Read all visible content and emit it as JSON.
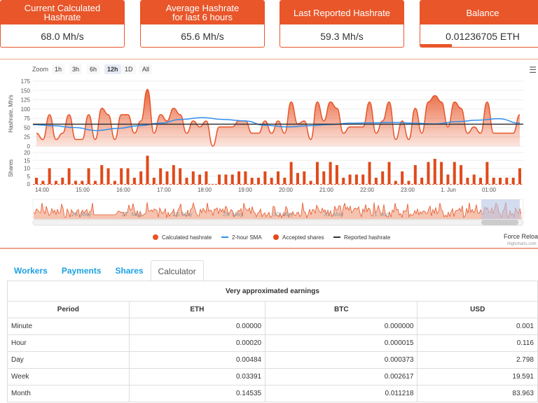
{
  "cards": [
    {
      "title": "Current Calculated Hashrate",
      "value": "68.0 Mh/s"
    },
    {
      "title": "Average Hashrate for last 6 hours",
      "value": "65.6 Mh/s"
    },
    {
      "title": "Last Reported Hashrate",
      "value": "59.3 Mh/s"
    },
    {
      "title": "Balance",
      "value": "0.01236705 ETH",
      "progress": 0.25
    }
  ],
  "zoom": {
    "label": "Zoom",
    "buttons": [
      "1h",
      "3h",
      "6h",
      "12h",
      "1D",
      "All"
    ],
    "selected": "12h"
  },
  "chart_data": {
    "type": "area",
    "xlabels": [
      "14:00",
      "15:00",
      "16:00",
      "17:00",
      "18:00",
      "19:00",
      "20:00",
      "21:00",
      "22:00",
      "23:00",
      "1. Jun",
      "01:00"
    ],
    "start": "13:48",
    "interval_minutes": 10,
    "hashrate": {
      "ylabel": "Hashrate, Mh/s",
      "ylim": [
        0,
        175
      ],
      "yticks": [
        0,
        25,
        50,
        75,
        100,
        125,
        150,
        175
      ],
      "calculated": [
        35,
        18,
        85,
        18,
        35,
        85,
        18,
        18,
        85,
        18,
        102,
        85,
        18,
        85,
        85,
        35,
        68,
        153,
        35,
        85,
        68,
        102,
        85,
        35,
        68,
        52,
        68,
        0,
        52,
        52,
        52,
        68,
        68,
        35,
        35,
        68,
        35,
        68,
        35,
        119,
        60,
        68,
        18,
        119,
        68,
        119,
        102,
        35,
        52,
        52,
        52,
        119,
        35,
        68,
        119,
        18,
        68,
        18,
        102,
        35,
        119,
        136,
        119,
        52,
        119,
        102,
        35,
        52,
        35,
        119,
        35,
        35,
        35,
        35,
        85
      ],
      "sma": [
        58,
        55,
        50,
        42,
        48,
        55,
        62,
        72,
        77,
        72,
        68,
        56,
        52,
        55,
        58,
        62,
        63,
        64,
        62,
        60,
        66,
        70,
        74,
        62
      ],
      "reported": 59.3
    },
    "shares": {
      "ylabel": "Shares",
      "ylim": [
        0,
        20
      ],
      "yticks": [
        0,
        5,
        10,
        15,
        20
      ],
      "values": [
        4,
        2,
        10,
        2,
        4,
        10,
        2,
        2,
        10,
        2,
        12,
        10,
        2,
        10,
        10,
        4,
        8,
        18,
        4,
        10,
        8,
        12,
        10,
        4,
        8,
        6,
        8,
        0,
        6,
        6,
        6,
        8,
        8,
        4,
        4,
        8,
        4,
        8,
        4,
        14,
        7,
        8,
        2,
        14,
        8,
        14,
        12,
        4,
        6,
        6,
        6,
        14,
        4,
        8,
        14,
        2,
        8,
        2,
        12,
        4,
        14,
        16,
        14,
        6,
        14,
        12,
        4,
        6,
        4,
        14,
        4,
        4,
        4,
        4,
        10
      ]
    },
    "navigator_labels": [
      "26. May",
      "27. May",
      "28. May",
      "29. May",
      "30. May",
      "31. May",
      "1. Jun"
    ],
    "legend": [
      "Calculated hashrate",
      "2-hour SMA",
      "Accepted shares",
      "Reported hashrate"
    ],
    "colors": {
      "calculated": "#e8562a",
      "sma": "#2f8ff0",
      "shares": "#e04a1a",
      "reported": "#333333"
    }
  },
  "force_reload": "Force Reload",
  "credits": "Highcharts.com",
  "tabs": [
    "Workers",
    "Payments",
    "Shares",
    "Calculator"
  ],
  "active_tab": "Calculator",
  "table": {
    "title": "Very approximated earnings",
    "headers": [
      "Period",
      "ETH",
      "BTC",
      "USD"
    ],
    "rows": [
      [
        "Minute",
        "0.00000",
        "0.000000",
        "0.001"
      ],
      [
        "Hour",
        "0.00020",
        "0.000015",
        "0.116"
      ],
      [
        "Day",
        "0.00484",
        "0.000373",
        "2.798"
      ],
      [
        "Week",
        "0.03391",
        "0.002617",
        "19.591"
      ],
      [
        "Month",
        "0.14535",
        "0.011218",
        "83.963"
      ]
    ]
  }
}
